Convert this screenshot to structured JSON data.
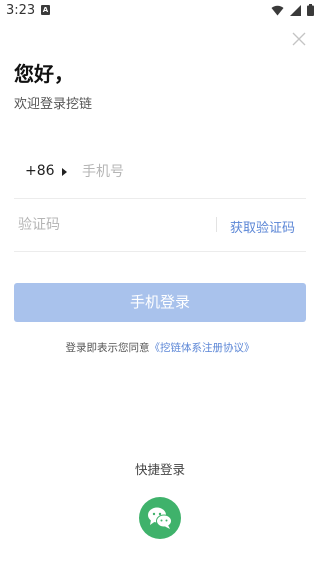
{
  "status_bar": {
    "time": "3:23",
    "notification_glyph": "A",
    "icons": [
      "wifi-icon",
      "signal-icon",
      "battery-icon"
    ]
  },
  "header": {
    "close_icon": "close-icon",
    "greeting": "您好，",
    "welcome": "欢迎登录挖链"
  },
  "phone": {
    "country_code": "+86",
    "placeholder": "手机号",
    "value": ""
  },
  "code": {
    "placeholder": "验证码",
    "value": "",
    "get_code_label": "获取验证码"
  },
  "login_button": "手机登录",
  "agreement": {
    "prefix": "登录即表示您同意",
    "link": "《挖链体系注册协议》"
  },
  "quick_login": {
    "label": "快捷登录",
    "wechat_icon": "wechat-icon"
  },
  "colors": {
    "accent": "#5b86d6",
    "login_button": "#a9c2ec",
    "wechat": "#3fb26b"
  }
}
